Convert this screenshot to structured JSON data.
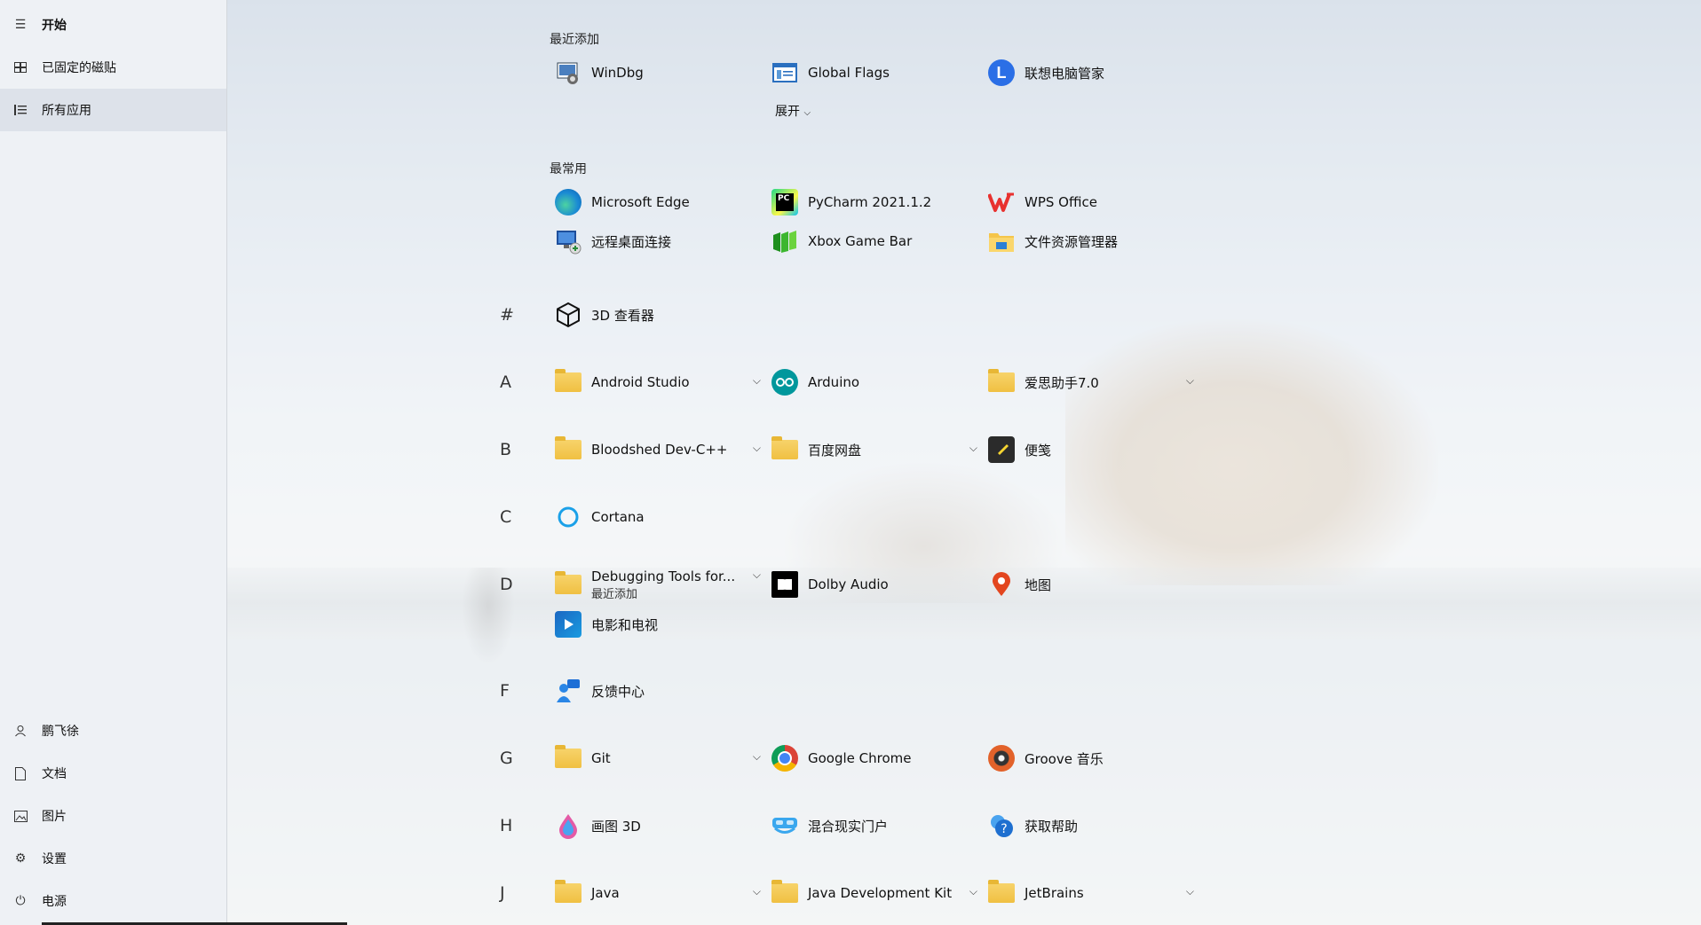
{
  "sidebar": {
    "top": [
      {
        "label": "开始",
        "icon": "hamburger-icon"
      },
      {
        "label": "已固定的磁贴",
        "icon": "tiles-icon"
      },
      {
        "label": "所有应用",
        "icon": "list-icon"
      }
    ],
    "bottom": [
      {
        "label": "鹏飞徐",
        "icon": "user-icon"
      },
      {
        "label": "文档",
        "icon": "document-icon"
      },
      {
        "label": "图片",
        "icon": "picture-icon"
      },
      {
        "label": "设置",
        "icon": "gear-icon"
      },
      {
        "label": "电源",
        "icon": "power-icon"
      }
    ]
  },
  "recent": {
    "title": "最近添加",
    "apps": [
      "WinDbg",
      "Global Flags",
      "联想电脑管家"
    ],
    "expand_label": "展开"
  },
  "frequent": {
    "title": "最常用",
    "apps": [
      "Microsoft Edge",
      "PyCharm 2021.1.2",
      "WPS Office",
      "远程桌面连接",
      "Xbox Game Bar",
      "文件资源管理器"
    ]
  },
  "groups": {
    "hash": {
      "letter": "#",
      "apps": [
        "3D 查看器"
      ]
    },
    "A": {
      "letter": "A",
      "apps": [
        "Android Studio",
        "Arduino",
        "爱思助手7.0"
      ]
    },
    "B": {
      "letter": "B",
      "apps": [
        "Bloodshed Dev-C++",
        "百度网盘",
        "便笺"
      ]
    },
    "C": {
      "letter": "C",
      "apps": [
        "Cortana"
      ]
    },
    "D": {
      "letter": "D",
      "apps": [
        "Debugging Tools for...",
        "Dolby Audio",
        "地图",
        "电影和电视"
      ],
      "sub": "最近添加"
    },
    "F": {
      "letter": "F",
      "apps": [
        "反馈中心"
      ]
    },
    "G": {
      "letter": "G",
      "apps": [
        "Git",
        "Google Chrome",
        "Groove 音乐"
      ]
    },
    "H": {
      "letter": "H",
      "apps": [
        "画图 3D",
        "混合现实门户",
        "获取帮助"
      ]
    },
    "J": {
      "letter": "J",
      "apps": [
        "Java",
        "Java Development Kit",
        "JetBrains"
      ]
    }
  },
  "colors": {
    "sidebar_bg": "#eef1f5",
    "active_bg": "#dde2ea",
    "edge_blue": "#1a8ad4",
    "chrome_red": "#db4437",
    "folder_yellow": "#f0c042"
  }
}
